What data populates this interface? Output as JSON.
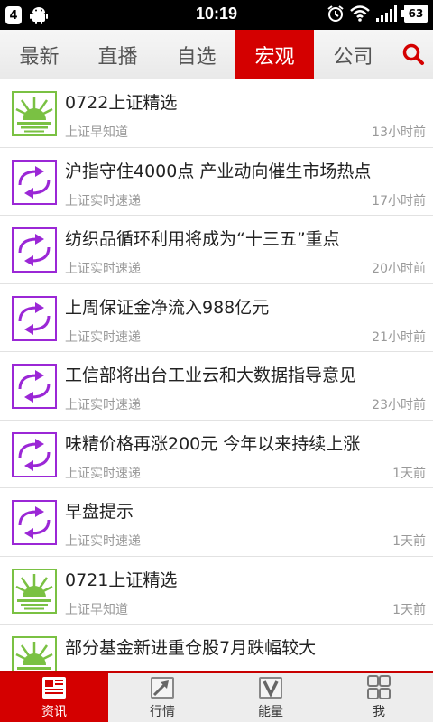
{
  "status_bar": {
    "notification_count": "4",
    "time": "10:19",
    "battery": "63",
    "icons": [
      "android-icon",
      "alarm-icon",
      "wifi-icon",
      "signal-icon",
      "battery-icon"
    ]
  },
  "tabs": [
    {
      "label": "最新",
      "active": false
    },
    {
      "label": "直播",
      "active": false
    },
    {
      "label": "自选",
      "active": false
    },
    {
      "label": "宏观",
      "active": true
    },
    {
      "label": "公司",
      "active": false
    }
  ],
  "search_icon": "search-icon",
  "colors": {
    "accent": "#d40000",
    "green_icon": "#7ac143",
    "purple_icon": "#9b27d6"
  },
  "feed": [
    {
      "icon": "sunrise-icon",
      "title": "0722上证精选",
      "source": "上证早知道",
      "time": "13小时前"
    },
    {
      "icon": "refresh-arrows-icon",
      "title": "沪指守住4000点 产业动向催生市场热点",
      "source": "上证实时速递",
      "time": "17小时前"
    },
    {
      "icon": "refresh-arrows-icon",
      "title": "纺织品循环利用将成为“十三五”重点",
      "source": "上证实时速递",
      "time": "20小时前"
    },
    {
      "icon": "refresh-arrows-icon",
      "title": "上周保证金净流入988亿元",
      "source": "上证实时速递",
      "time": "21小时前"
    },
    {
      "icon": "refresh-arrows-icon",
      "title": "工信部将出台工业云和大数据指导意见",
      "source": "上证实时速递",
      "time": "23小时前"
    },
    {
      "icon": "refresh-arrows-icon",
      "title": "味精价格再涨200元 今年以来持续上涨",
      "source": "上证实时速递",
      "time": "1天前"
    },
    {
      "icon": "refresh-arrows-icon",
      "title": "早盘提示",
      "source": "上证实时速递",
      "time": "1天前"
    },
    {
      "icon": "sunrise-icon",
      "title": "0721上证精选",
      "source": "上证早知道",
      "time": "1天前"
    },
    {
      "icon": "sunrise-icon",
      "title": "部分基金新进重仓股7月跌幅较大",
      "source": "",
      "time": ""
    }
  ],
  "bottom_nav": [
    {
      "label": "资讯",
      "icon": "news-icon",
      "active": true
    },
    {
      "label": "行情",
      "icon": "chart-icon",
      "active": false
    },
    {
      "label": "能量",
      "icon": "energy-icon",
      "active": false
    },
    {
      "label": "我",
      "icon": "apps-grid-icon",
      "active": false
    }
  ]
}
